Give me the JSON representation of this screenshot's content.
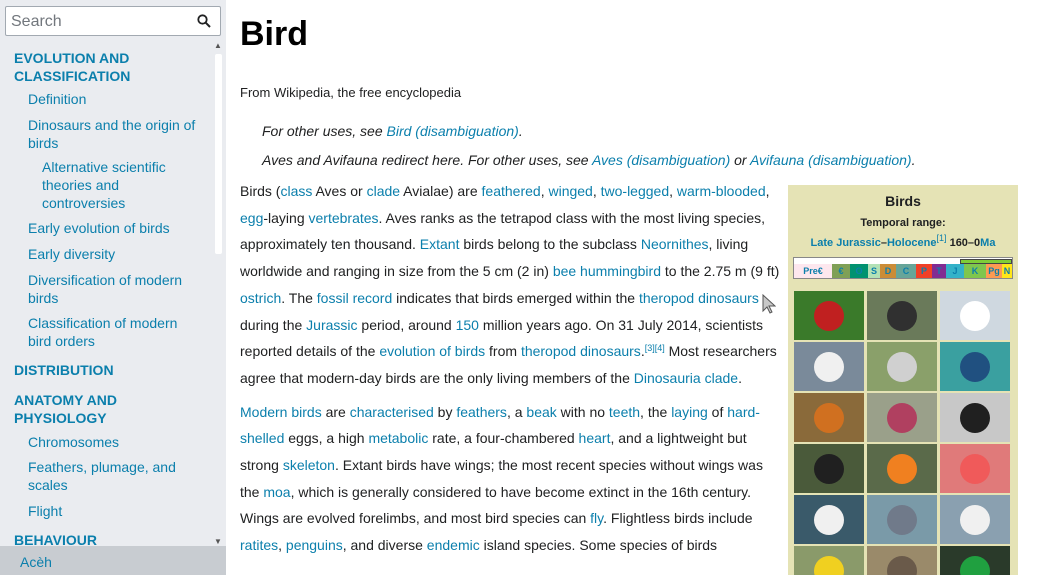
{
  "search": {
    "placeholder": "Search",
    "value": ""
  },
  "toc": {
    "items": [
      {
        "label": "EVOLUTION AND CLASSIFICATION",
        "level": 1
      },
      {
        "label": "Definition",
        "level": 2
      },
      {
        "label": "Dinosaurs and the origin of birds",
        "level": 2
      },
      {
        "label": "Alternative scientific theories and controversies",
        "level": 3
      },
      {
        "label": "Early evolution of birds",
        "level": 2
      },
      {
        "label": "Early diversity",
        "level": 2
      },
      {
        "label": "Diversification of modern birds",
        "level": 2
      },
      {
        "label": "Classification of modern bird orders",
        "level": 2
      },
      {
        "label": "DISTRIBUTION",
        "level": 1
      },
      {
        "label": "ANATOMY AND PHYSIOLOGY",
        "level": 1
      },
      {
        "label": "Chromosomes",
        "level": 2
      },
      {
        "label": "Feathers, plumage, and scales",
        "level": 2
      },
      {
        "label": "Flight",
        "level": 2
      },
      {
        "label": "BEHAVIOUR",
        "level": 1
      }
    ]
  },
  "languages": {
    "current": "Acèh"
  },
  "article": {
    "title": "Bird",
    "tagline": "From Wikipedia, the free encyclopedia",
    "hatnote1_prefix": "For other uses, see ",
    "hatnote1_link": "Bird (disambiguation)",
    "hatnote1_suffix": ".",
    "hatnote2_prefix": "Aves and Avifauna redirect here. For other uses, see ",
    "hatnote2_link1": "Aves (disambiguation)",
    "hatnote2_mid": " or ",
    "hatnote2_link2": "Avifauna (disambiguation)",
    "hatnote2_suffix": "."
  },
  "infobox": {
    "title": "Birds",
    "temporal_label": "Temporal range:",
    "range_link1": "Late Jurassic",
    "range_dash": "–",
    "range_link2": "Holocene",
    "range_ref": "[1]",
    "range_value": " 160–0",
    "range_unit": "Ma",
    "timescale": [
      "Pre€",
      "€",
      "O",
      "S",
      "D",
      "C",
      "P",
      "T",
      "J",
      "K",
      "Pg",
      "N"
    ],
    "timescale_colors": [
      "#f74370",
      "#7fa056",
      "#009270",
      "#b3e1b6",
      "#cb8c37",
      "#67a599",
      "#f04028",
      "#812b92",
      "#34b2c9",
      "#7fc64e",
      "#fd9a52",
      "#ffe619"
    ]
  },
  "gallery": {
    "colors": [
      [
        "#3a7a2a",
        "#6a7a5a",
        "#cfd8e0"
      ],
      [
        "#7a8a9a",
        "#8aa06a",
        "#3aa0a0"
      ],
      [
        "#8a6a3a",
        "#9aa08a",
        "#c8c8c8"
      ],
      [
        "#4a5a3a",
        "#5a6a4a",
        "#e07a7a"
      ],
      [
        "#3a5a6a",
        "#7a9aa8",
        "#8aa0b0"
      ],
      [
        "#8a9a6a",
        "#9a8a6a",
        "#2a3a2a"
      ]
    ],
    "accents": [
      [
        "#c02020",
        "#303030",
        "#ffffff"
      ],
      [
        "#f0f0f0",
        "#d0d0d0",
        "#205080"
      ],
      [
        "#d07020",
        "#b04060",
        "#202020"
      ],
      [
        "#202020",
        "#f08020",
        "#f05a5a"
      ],
      [
        "#f0f0f0",
        "#707a8a",
        "#f0f0f0"
      ],
      [
        "#f0d020",
        "#6a5a4a",
        "#20a040"
      ]
    ]
  },
  "cursor": "pointer-arrow-icon"
}
